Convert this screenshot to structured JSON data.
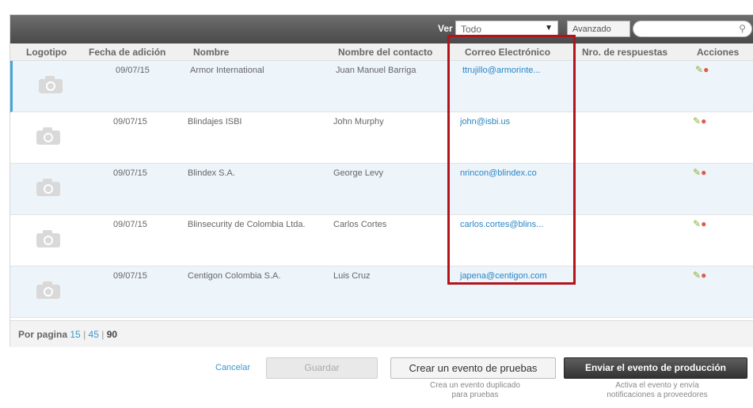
{
  "toolbar": {
    "ver_label": "Ver",
    "filter_value": "Todo",
    "advanced_label": "Avanzado",
    "search_placeholder": ""
  },
  "table": {
    "columns": [
      "Logotipo",
      "Fecha de adición",
      "Nombre",
      "Nombre del contacto",
      "Correo Electrónico",
      "Nro. de respuestas",
      "Acciones"
    ],
    "rows": [
      {
        "date": "09/07/15",
        "name": "Armor International",
        "contact": "Juan Manuel Barriga",
        "email": "ttrujillo@armorinte...",
        "responses": ""
      },
      {
        "date": "09/07/15",
        "name": "Blindajes ISBI",
        "contact": "John Murphy",
        "email": "john@isbi.us",
        "responses": ""
      },
      {
        "date": "09/07/15",
        "name": "Blindex S.A.",
        "contact": "George Levy",
        "email": "nrincon@blindex.co",
        "responses": ""
      },
      {
        "date": "09/07/15",
        "name": "Blinsecurity de Colombia Ltda.",
        "contact": "Carlos Cortes",
        "email": "carlos.cortes@blins...",
        "responses": ""
      },
      {
        "date": "09/07/15",
        "name": "Centigon Colombia S.A.",
        "contact": "Luis Cruz",
        "email": "japena@centigon.com",
        "responses": ""
      }
    ]
  },
  "pager": {
    "label": "Por pagina",
    "options": [
      "15",
      "45",
      "90"
    ],
    "separator": "|"
  },
  "footer": {
    "cancel_label": "Cancelar",
    "save_label": "Guardar",
    "test_event_label": "Crear un evento de pruebas",
    "test_event_note_1": "Crea un evento duplicado",
    "test_event_note_2": "para pruebas",
    "production_label": "Enviar el evento de producción",
    "production_note_1": "Activa el evento y envía",
    "production_note_2": "notificaciones a proveedores"
  },
  "colors": {
    "accent": "#3a97d4",
    "highlight": "#b3131a",
    "row_alt": "#edf4fa"
  }
}
